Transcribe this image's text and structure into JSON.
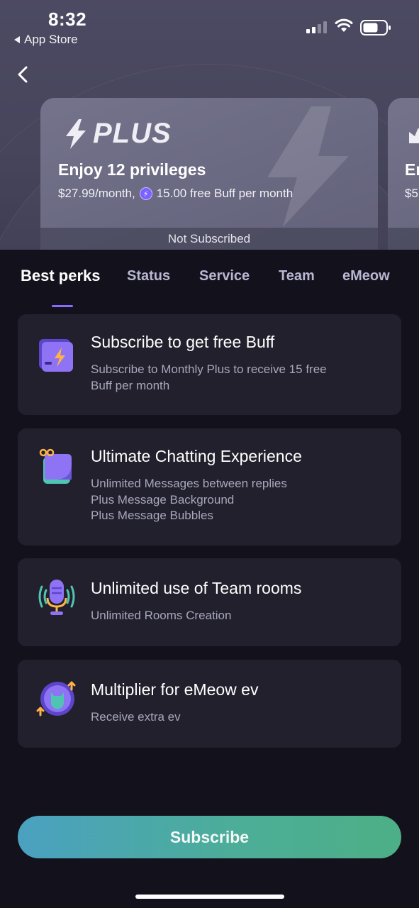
{
  "status_bar": {
    "time": "8:32",
    "back_app_label": "App Store"
  },
  "plan_card": {
    "logo_text": "PLUS",
    "title": "Enjoy 12 privileges",
    "price_text": "$27.99/month,",
    "buff_text": "15.00 free Buff per month",
    "status": "Not Subscribed"
  },
  "next_plan_card": {
    "title_fragment": "Er",
    "price_fragment": "$5"
  },
  "tabs": [
    {
      "label": "Best perks",
      "active": true
    },
    {
      "label": "Status",
      "active": false
    },
    {
      "label": "Service",
      "active": false
    },
    {
      "label": "Team",
      "active": false
    },
    {
      "label": "eMeow",
      "active": false
    }
  ],
  "perks": [
    {
      "icon": "wallet-bolt-icon",
      "title": "Subscribe to get free Buff",
      "description": [
        "Subscribe to Monthly Plus to receive 15 free",
        "Buff per month"
      ]
    },
    {
      "icon": "chat-gift-icon",
      "title": "Ultimate Chatting Experience",
      "description": [
        "Unlimited Messages between replies",
        "Plus Message Background",
        "Plus Message Bubbles"
      ]
    },
    {
      "icon": "microphone-icon",
      "title": "Unlimited use of Team rooms",
      "description": [
        "Unlimited Rooms Creation"
      ]
    },
    {
      "icon": "emeow-multiplier-icon",
      "title": "Multiplier for eMeow ev",
      "description": [
        "Receive extra ev"
      ]
    }
  ],
  "subscribe_button": {
    "label": "Subscribe"
  },
  "colors": {
    "accent": "#8a6bff",
    "background": "#13121c",
    "card": "#21202c",
    "subscribe_start": "#4aa1c0",
    "subscribe_end": "#4daf86"
  }
}
